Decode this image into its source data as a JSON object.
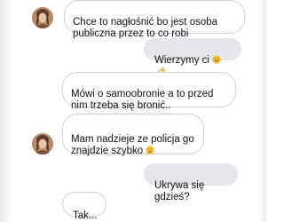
{
  "conversation": {
    "messages": [
      {
        "direction": "incoming",
        "text": "Chce to nagłośnić bo jest osoba\npubliczna przez to co robi",
        "has_avatar": true
      },
      {
        "direction": "outgoing",
        "text": "Wierzymy ci",
        "emojis": [
          "smiling-face-emoji",
          "ok-hand-emoji"
        ]
      },
      {
        "direction": "incoming",
        "text": "Mówi o samoobronie a to przed\nnim trzeba się bronić..",
        "has_avatar": false
      },
      {
        "direction": "incoming",
        "text": "Mam nadzieje ze policja go\nznajdzie szybko",
        "has_avatar": true,
        "emojis": [
          "disappointed-face-emoji"
        ]
      },
      {
        "direction": "outgoing",
        "text": "Ukrywa się gdzieś?"
      },
      {
        "direction": "incoming",
        "text": "Tak...",
        "has_avatar": false
      }
    ]
  },
  "colors": {
    "incoming_bubble_bg": "#ffffff",
    "incoming_bubble_border": "#cfd1d4",
    "outgoing_bubble_bg": "#e4e6eb",
    "text": "#111111"
  }
}
